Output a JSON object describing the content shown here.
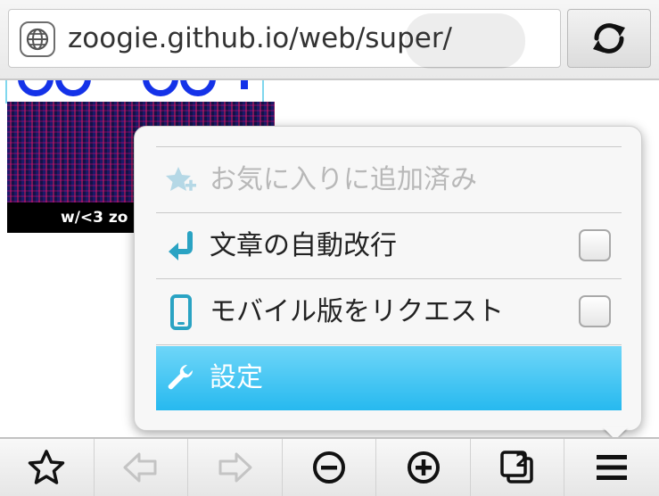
{
  "address_bar": {
    "url": "zoogie.github.io/web/super/"
  },
  "page": {
    "caption": "w/<3 zo"
  },
  "menu": {
    "items": [
      {
        "label": "お気に入りに追加済み",
        "icon": "star-add-icon",
        "state": "disabled"
      },
      {
        "label": "文章の自動改行",
        "icon": "return-arrow-icon",
        "checkbox": false
      },
      {
        "label": "モバイル版をリクエスト",
        "icon": "smartphone-icon",
        "checkbox": false
      },
      {
        "label": "設定",
        "icon": "wrench-icon",
        "state": "selected"
      }
    ]
  },
  "toolbar": {
    "buttons": [
      {
        "icon": "star-icon",
        "enabled": true
      },
      {
        "icon": "back-arrow-icon",
        "enabled": false
      },
      {
        "icon": "forward-arrow-icon",
        "enabled": false
      },
      {
        "icon": "zoom-out-icon",
        "enabled": true
      },
      {
        "icon": "zoom-in-icon",
        "enabled": true
      },
      {
        "icon": "tabs-icon",
        "enabled": true,
        "badge": "2"
      },
      {
        "icon": "menu-icon",
        "enabled": true
      }
    ]
  },
  "colors": {
    "selected_gradient_top": "#6fd6f8",
    "selected_gradient_bottom": "#27b9ef",
    "icon_teal": "#2aa3c3",
    "disabled_icon": "#b5d8e6"
  }
}
